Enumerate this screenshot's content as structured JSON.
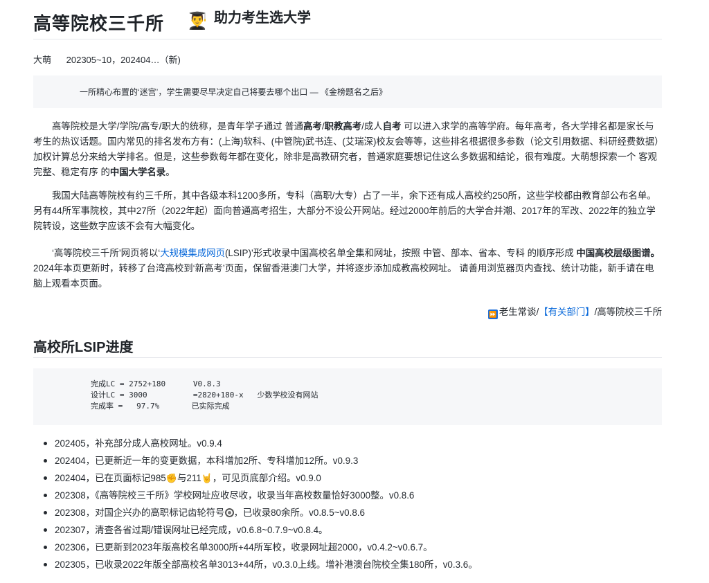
{
  "header": {
    "title": "高等院校三千所",
    "title_emoji": "👨‍🎓",
    "subtitle": "助力考生选大学",
    "author": "大萌",
    "versions": "202305~10，202404…（新)"
  },
  "quote": "一所精心布置的‘迷宫’，学生需要尽早决定自己将要去哪个出口 — 《金榜题名之后》",
  "intro": {
    "p1_a": "高等院校是大学/学院/高专/职大的统称，是青年学子通过 普通",
    "p1_b1": "高考",
    "p1_c": "/",
    "p1_b2": "职教高考",
    "p1_d": "/成人",
    "p1_b3": "自考",
    "p1_e": " 可以进入求学的高等学府。每年高考，各大学排名都是家长与考生的热议话题。国内常见的排名发布方有：(上海)软科、(中管院)武书连、(艾瑞深)校友会等等，这些排名根据很多参数（论文引用数据、科研经费数据）加权计算总分来给大学排名。但是，这些参数每年都在变化，除非是高教研究者，普通家庭要想记住这么多数据和结论，很有难度。大萌想探索一个 客观完整、稳定有序 的",
    "p1_b4": "中国大学名录",
    "p1_f": "。",
    "p2": "我国大陆高等院校有约三千所，其中各级本科1200多所，专科（高职/大专）占了一半，余下还有成人高校约250所，这些学校都由教育部公布名单。另有44所军事院校，其中27所（2022年起）面向普通高考招生，大部分不设公开网站。经过2000年前后的大学合并潮、2017年的军改、2022年的独立学院转设，这些数字应该不会有大幅变化。",
    "p3_a": "‘高等院校三千所’网页将以‘",
    "p3_link": "大规模集成网页",
    "p3_b": "(LSIP)’形式收录中国高校名单全集和网址，按照 中管、部本、省本、专科 的顺序形成 ",
    "p3_bold": "中国高校层级图谱。",
    "p3_c": "2024年本页更新时，转移了台湾高校到‘新高考’页面，保留香港澳门大学，并将逐步添加成教高校网址。   请善用浏览器页内查找、统计功能，新手请在电脑上观看本页面。"
  },
  "breadcrumb": {
    "icon": "⏩",
    "part1": "老生常谈/",
    "link": "【有关部门】",
    "part2": "/高等院校三千所"
  },
  "progress": {
    "heading": "高校所LSIP进度",
    "code": "完成LC = 2752+180      V0.8.3\n设计LC = 3000          =2820+180-x   少数学校没有网站\n完成率 =   97.7%       已实际完成"
  },
  "changelog": [
    {
      "text": "202405，补充部分成人高校网址。v0.9.4"
    },
    {
      "a": "202404，已在页面标记985",
      "e1": "✊",
      "b": "与211",
      "e2": "🤘",
      "c": "，可见页底部介绍。v0.9.0"
    },
    {
      "text": "202308，《高等院校三千所》学校网址应收尽收，收录当年高校数量恰好3000整。v0.8.6"
    },
    {
      "a": "202308，对国企兴办的高职标记齿轮符号",
      "c": "，已收录80余所。v0.8.5~v0.8.6"
    },
    {
      "text": "202307，清查各省过期/错误网址已经完成，v0.6.8~0.7.9~v0.8.4。"
    },
    {
      "text": "202306，已更新到2023年版高校名单3000所+44所军校，收录网址超2000，v0.4.2~v0.6.7。"
    },
    {
      "text": "202305，已收录2022年版全部高校名单3013+44所，v0.3.0上线。增补港澳台院校全集180所，v0.3.6。"
    }
  ],
  "changelog_extra": "202404，已更新近一年的变更数据，本科增加2所、专科增加12所。v0.9.3",
  "colors": {
    "link": "#0969da",
    "quote_bg": "#f6f7f9",
    "ff_icon": "#1e6fd9"
  }
}
